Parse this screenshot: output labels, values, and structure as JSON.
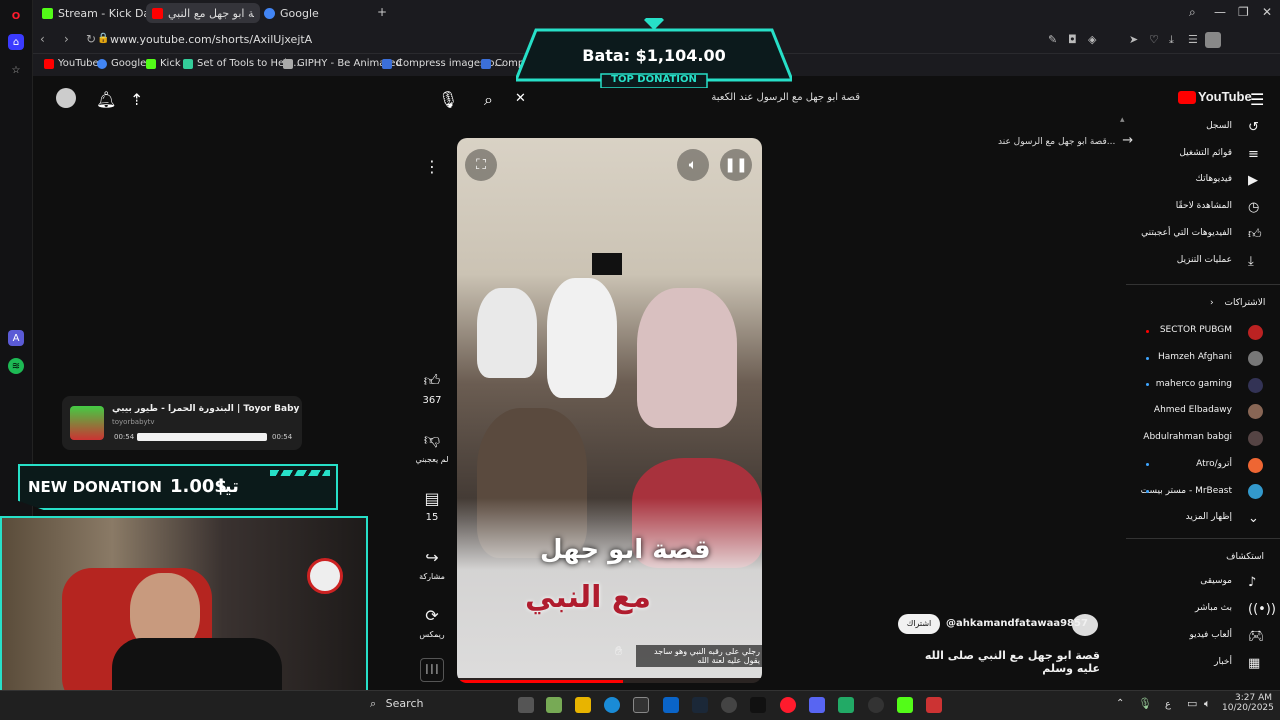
{
  "browser": {
    "tabs": [
      {
        "label": "Stream - Kick Dashboard"
      },
      {
        "label": "قصة ابو جهل مع النبي"
      },
      {
        "label": "Google"
      }
    ],
    "url": "www.youtube.com/shorts/AxilUjxejtA",
    "bookmarks": [
      "YouTube",
      "Google",
      "Kick",
      "Set of Tools to Help...",
      "GIPHY - Be Animated",
      "Compress images o...",
      "Compress"
    ]
  },
  "youtube": {
    "logo_text": "YouTube",
    "search_query": "قصة ابو جهل مع الرسول عند الكعبة",
    "back_link_text": "قصة ابو جهل مع الرسول عند...",
    "guide_items": [
      "السجل",
      "قوائم التشغيل",
      "فيديوهاتك",
      "المشاهدة لاحقًا",
      "الفيديوهات التي أعجبتني",
      "عمليات التنزيل"
    ],
    "subscriptions_header": "الاشتراكات",
    "subscriptions": [
      "SECTOR PUBGM",
      "Hamzeh Afghani",
      "maherco gaming",
      "Ahmed Elbadawy",
      "Abdulrahman babgi",
      "Atro/أترو",
      "مستر بيست - MrBeast"
    ],
    "show_more": "إظهار المزيد",
    "explore_header": "استكشاف",
    "explore_items": [
      "موسيقى",
      "بث مباشر",
      "ألعاب فيديو",
      "أخبار"
    ],
    "actions": {
      "likes": "367",
      "dislike_label": "لم يعجبني",
      "comments": "15",
      "share_label": "مشاركة",
      "remix_label": "ريمكس"
    },
    "channel": {
      "subscribe_label": "اشتراك",
      "handle": "@ahkamandfatawaa9857"
    },
    "video_title": "قصة ابو جهل مع النبي صلى الله عليه وسلم",
    "overlay_line1": "قصة ابو جهل",
    "overlay_line2": "مع النبي",
    "caption_text": "رجلي على رقبه النبي وهو ساجد يقول عليه لعنة الله"
  },
  "stream_overlay": {
    "top_donation_amount": "Bata: $1,104.00",
    "top_donation_label": "TOP DONATION",
    "new_donation_label": "NEW DONATION",
    "new_donation_amount": "1.00$",
    "new_donation_name": "تيا",
    "music_title": "البندورة الحمرا - طيور بيبي | Toyor Baby",
    "music_channel": "toyorbabytv",
    "music_time_start": "00:54",
    "music_time_end": "00:54",
    "music_progress": 1.0
  },
  "taskbar": {
    "search_label": "Search",
    "time": "3:27 AM",
    "date": "10/20/2025",
    "lang": "ع"
  },
  "colors": {
    "accent": "#27e0c8",
    "youtube_red": "#ff0000",
    "overlay_red": "#b01c2e"
  }
}
